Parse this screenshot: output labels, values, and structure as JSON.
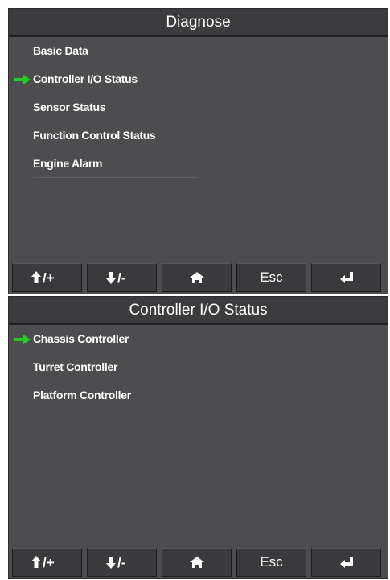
{
  "screen1": {
    "title": "Diagnose",
    "menu_items": [
      {
        "label": "Basic Data",
        "selected": false
      },
      {
        "label": "Controller I/O Status",
        "selected": true
      },
      {
        "label": "Sensor Status",
        "selected": false
      },
      {
        "label": "Function Control Status",
        "selected": false
      },
      {
        "label": "Engine Alarm",
        "selected": false
      }
    ]
  },
  "screen2": {
    "title": "Controller I/O Status",
    "menu_items": [
      {
        "label": "Chassis Controller",
        "selected": true
      },
      {
        "label": "Turret Controller",
        "selected": false
      },
      {
        "label": "Platform Controller",
        "selected": false
      }
    ]
  },
  "buttons": {
    "up_plus": {
      "icon": "up-arrow-icon",
      "suffix": "/+"
    },
    "down_minus": {
      "icon": "down-arrow-icon",
      "suffix": "/-"
    },
    "home": {
      "icon": "home-icon"
    },
    "esc": {
      "label": "Esc"
    },
    "enter": {
      "icon": "enter-icon"
    }
  },
  "colors": {
    "selection_arrow": "#22cc22",
    "screen_bg": "#4d4d4f",
    "title_bg": "#3c3c3e",
    "button_bg": "#3a3a3c"
  }
}
